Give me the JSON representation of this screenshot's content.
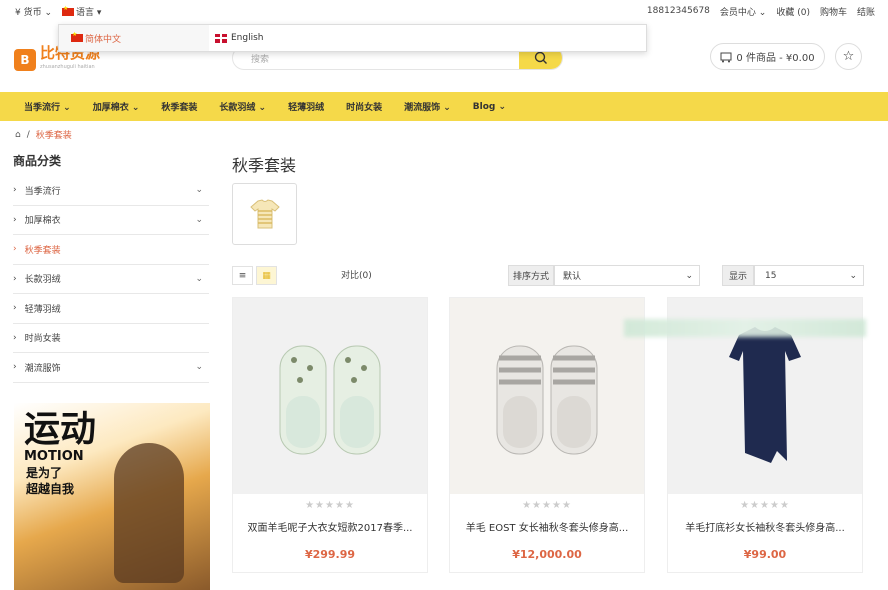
{
  "topbar": {
    "currency": "¥ 货币",
    "language": "语言",
    "phone": "18812345678",
    "member": "会员中心",
    "favorites": "收藏 (0)",
    "cart": "购物车",
    "checkout": "结账"
  },
  "lang_dropdown": {
    "zh": "简体中文",
    "en": "English"
  },
  "logo": {
    "name": "比特资源",
    "sub": "zhusanzhuguli haitian"
  },
  "search": {
    "placeholder": "搜索"
  },
  "cart_widget": {
    "label": "0 件商品 - ¥0.00"
  },
  "nav": {
    "items": [
      "当季流行 ⌄",
      "加厚棉衣 ⌄",
      "秋季套装",
      "长款羽绒 ⌄",
      "轻薄羽绒",
      "时尚女装",
      "潮流服饰 ⌄",
      "Blog ⌄"
    ]
  },
  "breadcrumb": {
    "current": "秋季套装"
  },
  "sidebar": {
    "title": "商品分类",
    "categories": [
      {
        "label": "当季流行",
        "chevron": true,
        "active": false
      },
      {
        "label": "加厚棉衣",
        "chevron": true,
        "active": false
      },
      {
        "label": "秋季套装",
        "chevron": false,
        "active": true
      },
      {
        "label": "长款羽绒",
        "chevron": true,
        "active": false
      },
      {
        "label": "轻薄羽绒",
        "chevron": false,
        "active": false
      },
      {
        "label": "时尚女装",
        "chevron": false,
        "active": false
      },
      {
        "label": "潮流服饰",
        "chevron": true,
        "active": false
      }
    ]
  },
  "banner": {
    "big": "运动",
    "motion": "MOTION",
    "line1": "是为了",
    "line2": "超越自我"
  },
  "main": {
    "title": "秋季套装"
  },
  "toolbar": {
    "compare": "对比(0)",
    "sort_label": "排序方式",
    "sort_value": "默认",
    "show_label": "显示",
    "show_value": "15"
  },
  "products": [
    {
      "name": "双面羊毛呢子大衣女短款2017春季...",
      "price": "¥299.99"
    },
    {
      "name": "羊毛 EOST 女长袖秋冬套头修身高...",
      "price": "¥12,000.00"
    },
    {
      "name": "羊毛打底衫女长袖秋冬套头修身高...",
      "price": "¥99.00"
    }
  ],
  "colors": {
    "accent": "#f5d949",
    "price": "#d64444",
    "logo": "#f0801c"
  }
}
